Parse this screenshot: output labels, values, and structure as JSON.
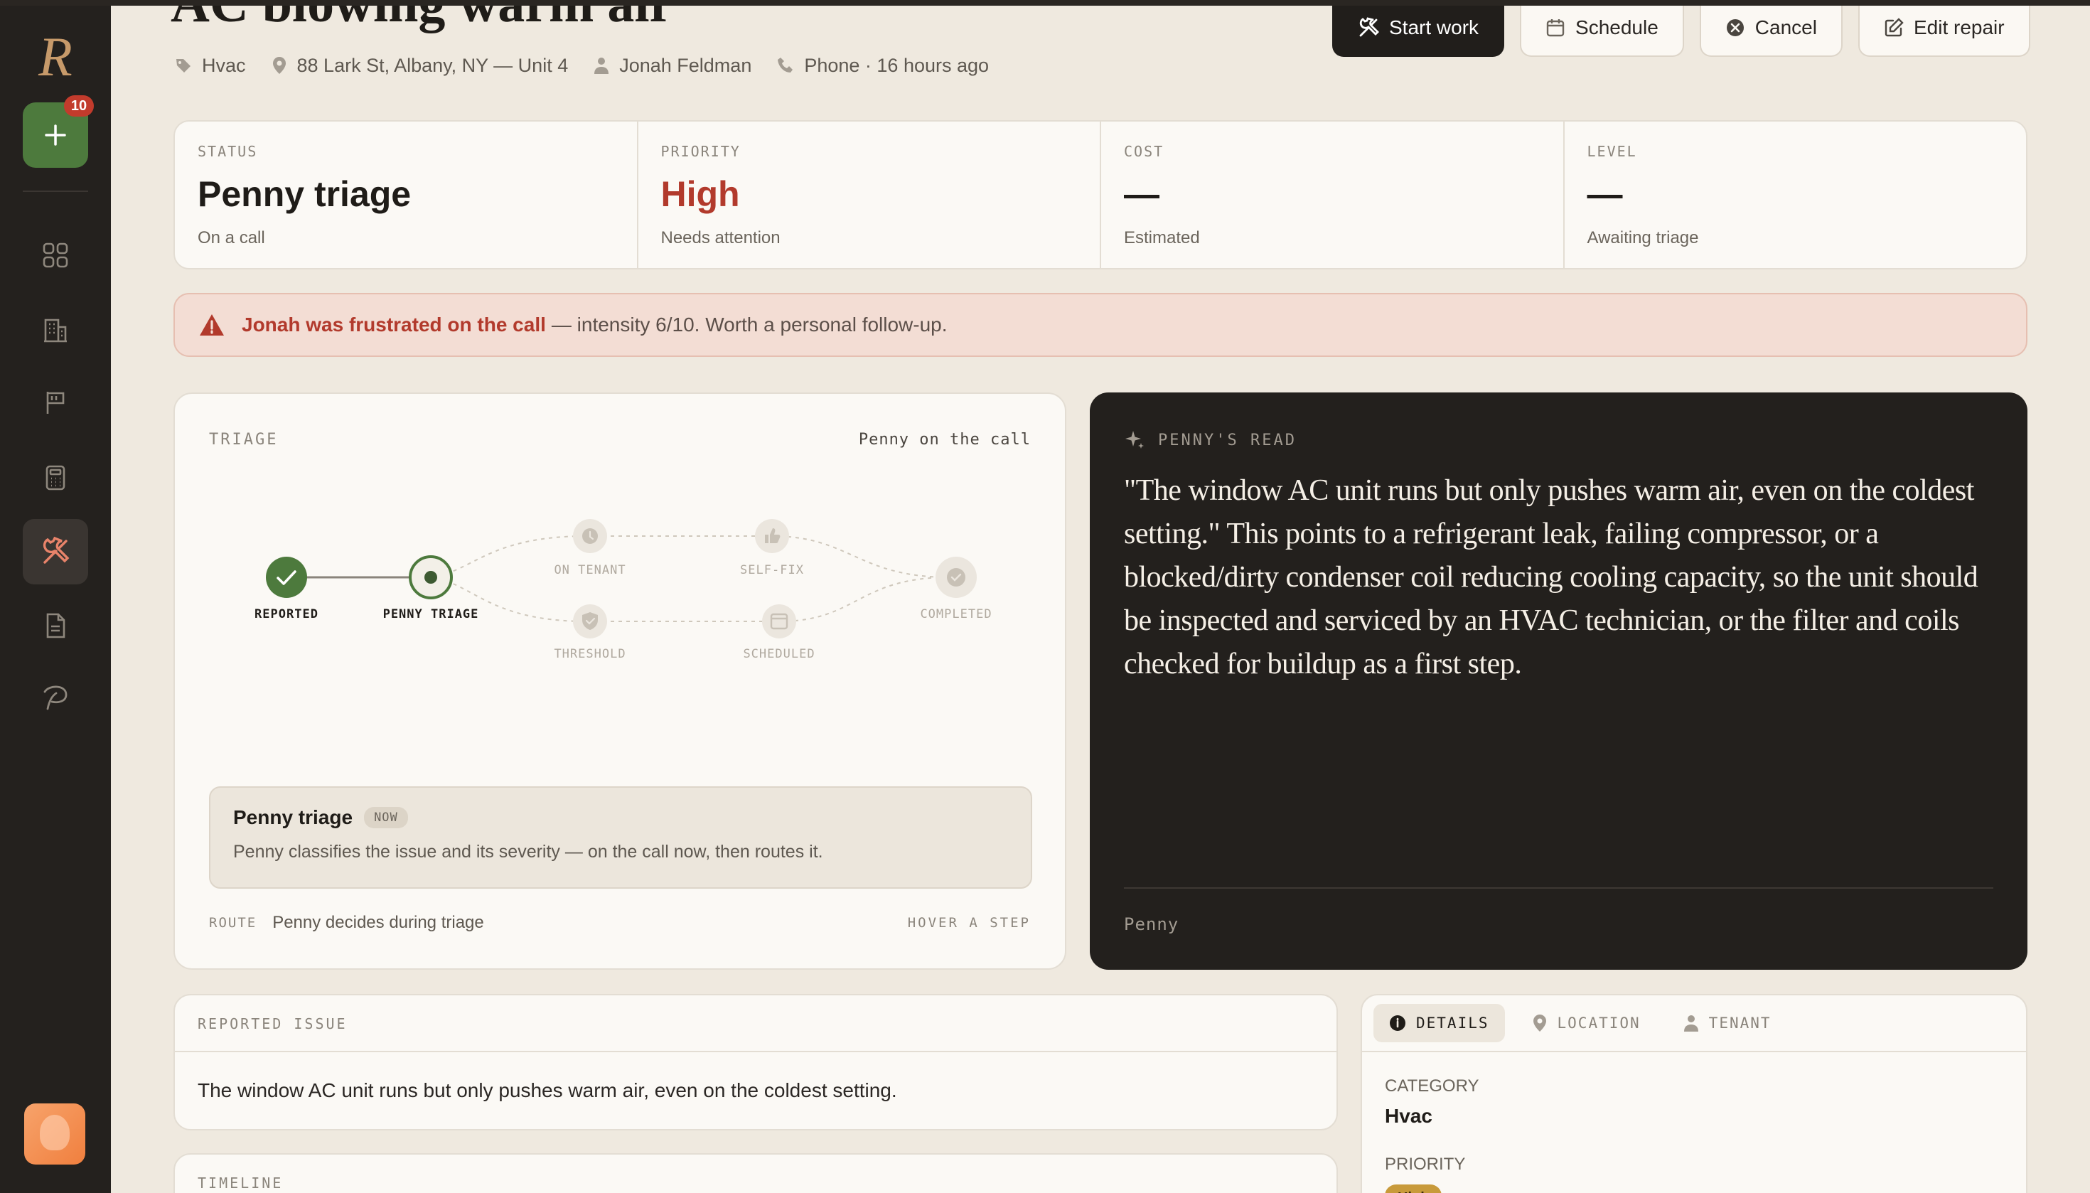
{
  "app": {
    "logo": "R",
    "new_count": "10"
  },
  "sidebar": {
    "items": [
      {
        "name": "dashboard",
        "icon": "grid-icon"
      },
      {
        "name": "properties",
        "icon": "building-icon"
      },
      {
        "name": "issues",
        "icon": "flag-icon"
      },
      {
        "name": "billing",
        "icon": "calculator-icon"
      },
      {
        "name": "repairs",
        "icon": "tools-icon",
        "active": true
      },
      {
        "name": "documents",
        "icon": "document-icon"
      },
      {
        "name": "penny",
        "icon": "penny-icon"
      }
    ]
  },
  "header": {
    "title": "AC blowing warm air",
    "category": "Hvac",
    "address": "88 Lark St, Albany, NY — Unit 4",
    "tenant": "Jonah Feldman",
    "channel": "Phone · 16 hours ago"
  },
  "actions": {
    "start": "Start work",
    "schedule": "Schedule",
    "cancel": "Cancel",
    "edit": "Edit repair"
  },
  "stats": {
    "status": {
      "label": "STATUS",
      "value": "Penny triage",
      "sub": "On a call"
    },
    "priority": {
      "label": "PRIORITY",
      "value": "High",
      "sub": "Needs attention"
    },
    "cost": {
      "label": "COST",
      "value": "—",
      "sub": "Estimated"
    },
    "level": {
      "label": "LEVEL",
      "value": "—",
      "sub": "Awaiting triage"
    }
  },
  "alert": {
    "lead": "Jonah was frustrated on the call",
    "rest": "— intensity 6/10. Worth a personal follow-up."
  },
  "triage": {
    "label": "TRIAGE",
    "right": "Penny on the call",
    "nodes": {
      "reported": "REPORTED",
      "penny_triage": "PENNY TRIAGE",
      "on_tenant": "ON TENANT",
      "self_fix": "SELF-FIX",
      "threshold": "THRESHOLD",
      "scheduled": "SCHEDULED",
      "completed": "COMPLETED"
    },
    "step": {
      "title": "Penny triage",
      "pill": "NOW",
      "desc": "Penny classifies the issue and its severity — on the call now, then routes it."
    },
    "route_label": "ROUTE",
    "route_value": "Penny decides during triage",
    "hint": "HOVER A STEP"
  },
  "read": {
    "label": "PENNY'S READ",
    "quote": "\"The window AC unit runs but only pushes warm air, even on the coldest setting.\" This points to a refrigerant leak, failing compressor, or a blocked/dirty condenser coil reducing cooling capacity, so the unit should be inspected and serviced by an HVAC technician, or the filter and coils checked for buildup as a first step.",
    "author": "Penny"
  },
  "issue": {
    "label": "REPORTED ISSUE",
    "text": "The window AC unit runs but only pushes warm air, even on the coldest setting."
  },
  "timeline": {
    "label": "TIMELINE"
  },
  "details": {
    "tabs": [
      "DETAILS",
      "LOCATION",
      "TENANT"
    ],
    "category_label": "CATEGORY",
    "category": "Hvac",
    "priority_label": "PRIORITY",
    "priority": "High"
  },
  "colors": {
    "accent_green": "#4d7a3d",
    "danger": "#b23a2c",
    "dark": "#23201d"
  }
}
